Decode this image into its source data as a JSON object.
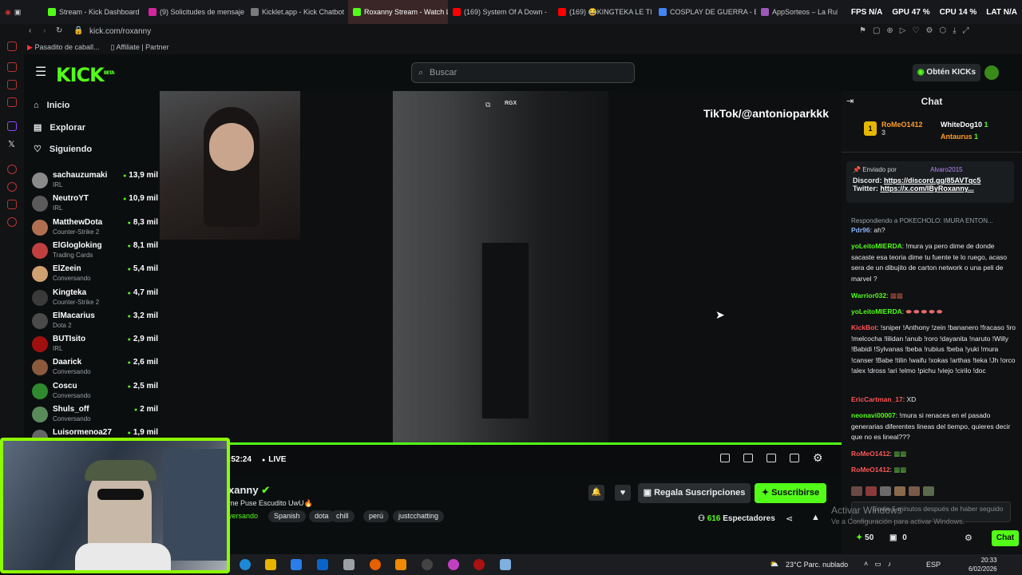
{
  "browser": {
    "tabs": [
      {
        "label": "Stream - Kick Dashboard",
        "color": "#53fc18"
      },
      {
        "label": "(9) Solicitudes de mensaje",
        "color": "#d6249f"
      },
      {
        "label": "Kicklet.app - Kick Chatbot",
        "color": "#7a7a7a"
      },
      {
        "label": "Roxanny Stream - Watch L",
        "color": "#53fc18",
        "active": true
      },
      {
        "label": "(169) System Of A Down -",
        "color": "#ff0000"
      },
      {
        "label": "(169) 😂KINGTEKA LE TI",
        "color": "#ff0000"
      },
      {
        "label": "COSPLAY DE GUERRA - B",
        "color": "#4285f4"
      },
      {
        "label": "AppSorteos – La Ruleta",
        "color": "#9b59b6"
      }
    ],
    "hud": {
      "fps": "FPS N/A",
      "gpu": "GPU 47 %",
      "cpu": "CPU 14 %",
      "lat": "LAT N/A"
    },
    "url": "kick.com/roxanny",
    "bookmarks": [
      "Pasadito de caball...",
      "Affiliate | Partner"
    ]
  },
  "header": {
    "logo": "KICK",
    "logo_sup": "BETA",
    "search_placeholder": "Buscar",
    "get_kicks": "Obtén KICKs"
  },
  "sidebar": {
    "nav": [
      {
        "label": "Inicio",
        "icon": "home-icon"
      },
      {
        "label": "Explorar",
        "icon": "explore-icon"
      },
      {
        "label": "Siguiendo",
        "icon": "heart-icon"
      }
    ],
    "following": [
      {
        "name": "sachauzumaki",
        "category": "IRL",
        "viewers": "13,9 mil"
      },
      {
        "name": "NeutroYT",
        "category": "IRL",
        "viewers": "10,9 mil"
      },
      {
        "name": "MatthewDota",
        "category": "Counter-Strike 2",
        "viewers": "8,3 mil"
      },
      {
        "name": "ElGlogloking",
        "category": "Trading Cards",
        "viewers": "8,1 mil"
      },
      {
        "name": "ElZeein",
        "category": "Conversando",
        "viewers": "5,4 mil"
      },
      {
        "name": "Kingteka",
        "category": "Counter-Strike 2",
        "viewers": "4,7 mil"
      },
      {
        "name": "ElMacarius",
        "category": "Dota 2",
        "viewers": "3,2 mil"
      },
      {
        "name": "BUTIsito",
        "category": "IRL",
        "viewers": "2,9 mil"
      },
      {
        "name": "Daarick",
        "category": "Conversando",
        "viewers": "2,6 mil"
      },
      {
        "name": "Coscu",
        "category": "Conversando",
        "viewers": "2,5 mil"
      },
      {
        "name": "Shuls_off",
        "category": "Conversando",
        "viewers": "2 mil"
      },
      {
        "name": "Luisormenoa27",
        "category": "",
        "viewers": "1,9 mil"
      }
    ]
  },
  "video": {
    "overlay_text": "TikTok/@antonioparkkk",
    "rgx": "RGX"
  },
  "player": {
    "time": ":52:24",
    "live": "LIVE"
  },
  "stream": {
    "name": "xanny",
    "title": "me Puse Escudito UwU🔥",
    "category": "versando",
    "tags": [
      "Spanish",
      "dota",
      "chill",
      "perú",
      "justcchatting"
    ],
    "gift_label": "Regala Suscripciones",
    "subscribe_label": "Suscribirse",
    "viewers_count": "616",
    "viewers_label": "Espectadores"
  },
  "chat": {
    "title": "Chat",
    "top_gifters": [
      {
        "name": "RoMeO1412",
        "count": "3"
      },
      {
        "name": "WhiteDog10",
        "count": "1"
      },
      {
        "name": "Antaurus",
        "count": "1"
      }
    ],
    "pinned": {
      "sent_by": "Enviado por",
      "user": "Alvaro2015",
      "discord_label": "Discord:",
      "discord": "https://discord.gg/85AVTqc5",
      "twitter_label": "Twitter:",
      "twitter": "https://x.com/IByRoxanny..."
    },
    "reply_note": "Respondiendo a POKECHOLO: IMURA ENTON...",
    "messages": [
      {
        "user": "Pdr96",
        "text": "ah?",
        "color": "#8ab4f8"
      },
      {
        "user": "yoLeitoMIERDA",
        "text": "!mura ya pero dime de donde sacaste esa teoria dime tu fuente te lo ruego, acaso sera de un dibujito de carton network o una peli de marvel ?",
        "color": "#53fc18"
      },
      {
        "user": "Warrior032",
        "text": "",
        "color": "#53fc18"
      },
      {
        "user": "yoLeitoMIERDA",
        "text": "",
        "color": "#53fc18"
      },
      {
        "user": "KickBot",
        "text": "!sniper !Anthony !zein !bananero !fracaso !iro !melcocha !lilidan !anub !roro !dayanita !naruto !Willy !Babidi !Sylvanas !beba !rubius !beba !yuki !mura !canser !Babe !tilin !waifu !xokas !arthas !teka !Jh !orco !alex !dross !ari !elmo !pichu !viejo !cirilo !doc",
        "color": "#ff5555"
      },
      {
        "user": "EricCartman_17",
        "text": "XD",
        "color": "#ff5555"
      },
      {
        "user": "neonavi00007",
        "text": "!mura si renaces en el pasado generarias diferentes lineas del tiempo, quieres decir que no es lineal???",
        "color": "#53fc18"
      },
      {
        "user": "RoMeO1412",
        "text": "",
        "color": "#ff5555"
      },
      {
        "user": "RoMeO1412",
        "text": "",
        "color": "#ff5555"
      }
    ],
    "input_placeholder": "Envíe 5 minutos después de haber seguido",
    "kicks": "50",
    "gifts": "0",
    "chat_button": "Chat"
  },
  "windows": {
    "activate_title": "Activar Windows",
    "activate_sub": "Ve a Configuración para activar Windows.",
    "weather": "23°C  Parc. nublado",
    "lang": "ESP",
    "time": "20:33",
    "date": "6/02/2026"
  }
}
